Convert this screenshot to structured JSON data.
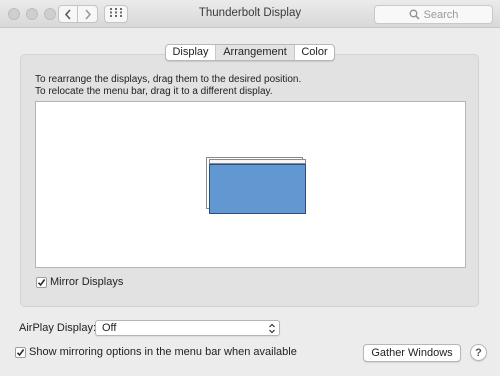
{
  "window": {
    "title": "Thunderbolt Display"
  },
  "toolbar": {
    "back_icon": "chevron-left-icon",
    "forward_icon": "chevron-right-icon",
    "show_all_icon": "grid-icon",
    "search_placeholder": "Search"
  },
  "tabs": [
    {
      "label": "Display",
      "selected": false
    },
    {
      "label": "Arrangement",
      "selected": true
    },
    {
      "label": "Color",
      "selected": false
    }
  ],
  "arrangement": {
    "instruction_1": "To rearrange the displays, drag them to the desired position.",
    "instruction_2": "To relocate the menu bar, drag it to a different display.",
    "display_color": "#6298d2",
    "mirror_label": "Mirror Displays",
    "mirror_checked": true
  },
  "airplay": {
    "label": "AirPlay Display:",
    "value": "Off"
  },
  "footer": {
    "show_mirroring_label": "Show mirroring options in the menu bar when available",
    "show_mirroring_checked": true,
    "gather_button_label": "Gather Windows",
    "help_label": "?"
  }
}
